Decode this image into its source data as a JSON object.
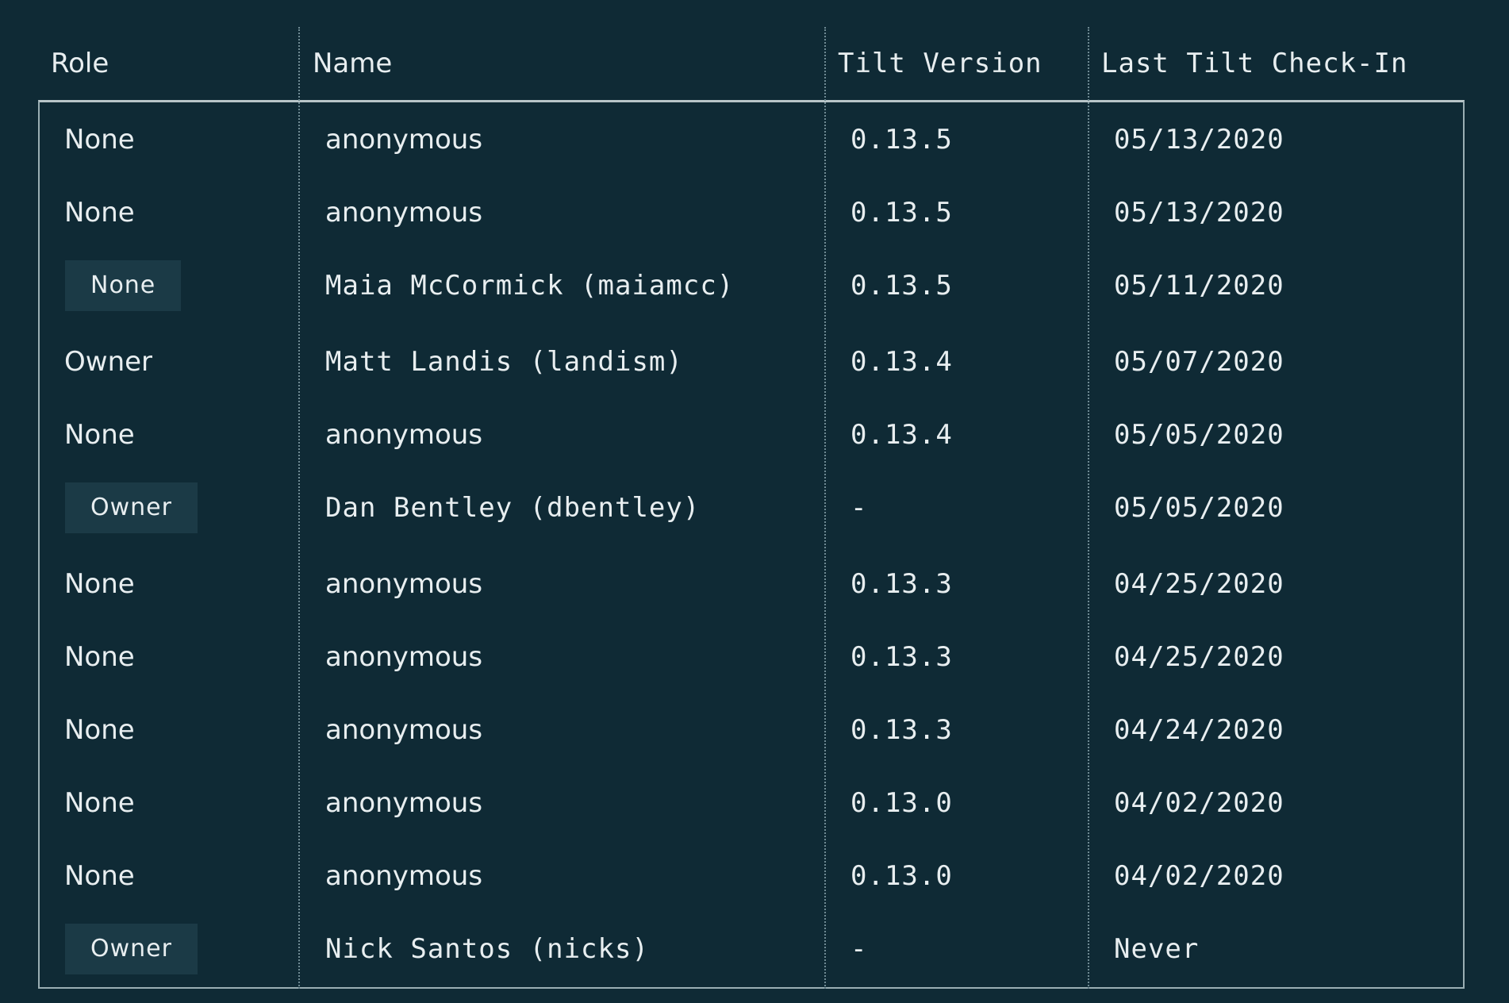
{
  "table": {
    "headers": {
      "role": "Role",
      "name": "Name",
      "version": "Tilt Version",
      "checkin": "Last Tilt Check-In"
    },
    "rows": [
      {
        "role": "None",
        "name": "anonymous",
        "version": "0.13.5",
        "checkin": "05/13/2020",
        "role_dropdown": false
      },
      {
        "role": "None",
        "name": "anonymous",
        "version": "0.13.5",
        "checkin": "05/13/2020",
        "role_dropdown": false
      },
      {
        "role": "None",
        "name": "Maia McCormick (maiamcc)",
        "version": "0.13.5",
        "checkin": "05/11/2020",
        "role_dropdown": true
      },
      {
        "role": "Owner",
        "name": "Matt Landis (landism)",
        "version": "0.13.4",
        "checkin": "05/07/2020",
        "role_dropdown": false
      },
      {
        "role": "None",
        "name": "anonymous",
        "version": "0.13.4",
        "checkin": "05/05/2020",
        "role_dropdown": false
      },
      {
        "role": "Owner",
        "name": "Dan Bentley (dbentley)",
        "version": "-",
        "checkin": "05/05/2020",
        "role_dropdown": true
      },
      {
        "role": "None",
        "name": "anonymous",
        "version": "0.13.3",
        "checkin": "04/25/2020",
        "role_dropdown": false
      },
      {
        "role": "None",
        "name": "anonymous",
        "version": "0.13.3",
        "checkin": "04/25/2020",
        "role_dropdown": false
      },
      {
        "role": "None",
        "name": "anonymous",
        "version": "0.13.3",
        "checkin": "04/24/2020",
        "role_dropdown": false
      },
      {
        "role": "None",
        "name": "anonymous",
        "version": "0.13.0",
        "checkin": "04/02/2020",
        "role_dropdown": false
      },
      {
        "role": "None",
        "name": "anonymous",
        "version": "0.13.0",
        "checkin": "04/02/2020",
        "role_dropdown": false
      },
      {
        "role": "Owner",
        "name": "Nick Santos (nicks)",
        "version": "-",
        "checkin": "Never",
        "role_dropdown": true
      }
    ]
  },
  "colors": {
    "background": "#0f2a35",
    "badge_background": "#1b3a46",
    "text": "#e8eef0",
    "border": "#9aaeb3",
    "divider": "#6f8a93"
  }
}
